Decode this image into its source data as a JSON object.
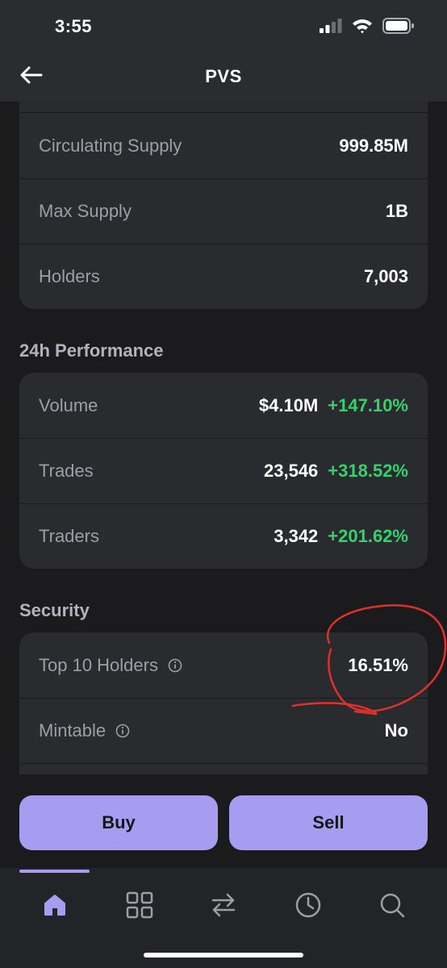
{
  "status_bar": {
    "time": "3:55"
  },
  "header": {
    "title": "PVS"
  },
  "supply": {
    "rows": [
      {
        "label": "Circulating Supply",
        "value": "999.85M"
      },
      {
        "label": "Max Supply",
        "value": "1B"
      },
      {
        "label": "Holders",
        "value": "7,003"
      }
    ]
  },
  "performance": {
    "title": "24h Performance",
    "rows": [
      {
        "label": "Volume",
        "value": "$4.10M",
        "change": "+147.10%"
      },
      {
        "label": "Trades",
        "value": "23,546",
        "change": "+318.52%"
      },
      {
        "label": "Traders",
        "value": "3,342",
        "change": "+201.62%"
      }
    ]
  },
  "security": {
    "title": "Security",
    "rows": [
      {
        "label": "Top 10 Holders",
        "value": "16.51%"
      },
      {
        "label": "Mintable",
        "value": "No"
      }
    ]
  },
  "actions": {
    "buy_label": "Buy",
    "sell_label": "Sell"
  },
  "tabs": [
    {
      "icon": "home-icon",
      "active": true
    },
    {
      "icon": "grid-icon",
      "active": false
    },
    {
      "icon": "swap-icon",
      "active": false
    },
    {
      "icon": "clock-icon",
      "active": false
    },
    {
      "icon": "search-icon",
      "active": false
    }
  ],
  "colors": {
    "background": "#1b1b1e",
    "card": "#2a2b2f",
    "accent": "#a69cf0",
    "positive": "#33d36c",
    "annotation": "#e0302a"
  }
}
